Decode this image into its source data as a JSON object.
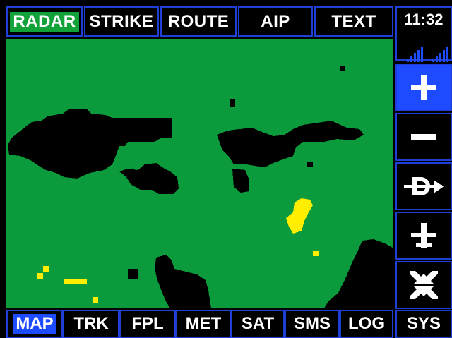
{
  "top_tabs": [
    {
      "label": "RADAR",
      "active": true
    },
    {
      "label": "STRIKE",
      "active": false
    },
    {
      "label": "ROUTE",
      "active": false
    },
    {
      "label": "AIP",
      "active": false
    },
    {
      "label": "TEXT",
      "active": false
    }
  ],
  "clock": {
    "time": "11:32",
    "signal_icons": [
      "signal-bars-icon",
      "signal-bars-icon"
    ]
  },
  "side_buttons": [
    {
      "name": "zoom-in-button",
      "icon": "plus-icon",
      "highlighted": true
    },
    {
      "name": "zoom-out-button",
      "icon": "minus-icon",
      "highlighted": false
    },
    {
      "name": "direct-to-button",
      "icon": "direct-to-icon",
      "highlighted": false
    },
    {
      "name": "aircraft-button",
      "icon": "aircraft-icon",
      "highlighted": false
    },
    {
      "name": "fullscreen-button",
      "icon": "collapse-arrows-icon",
      "highlighted": false
    }
  ],
  "bottom_tabs": [
    {
      "label": "MAP",
      "active": true
    },
    {
      "label": "TRK",
      "active": false
    },
    {
      "label": "FPL",
      "active": false
    },
    {
      "label": "MET",
      "active": false
    },
    {
      "label": "SAT",
      "active": false
    },
    {
      "label": "SMS",
      "active": false
    },
    {
      "label": "LOG",
      "active": false
    },
    {
      "label": "SYS",
      "active": false
    }
  ],
  "colors": {
    "map_background": "#0b9a3c",
    "land": "#000000",
    "weather_cell": "#ffee00",
    "accent": "#1e4bff",
    "active_tab": "#12a23a"
  }
}
